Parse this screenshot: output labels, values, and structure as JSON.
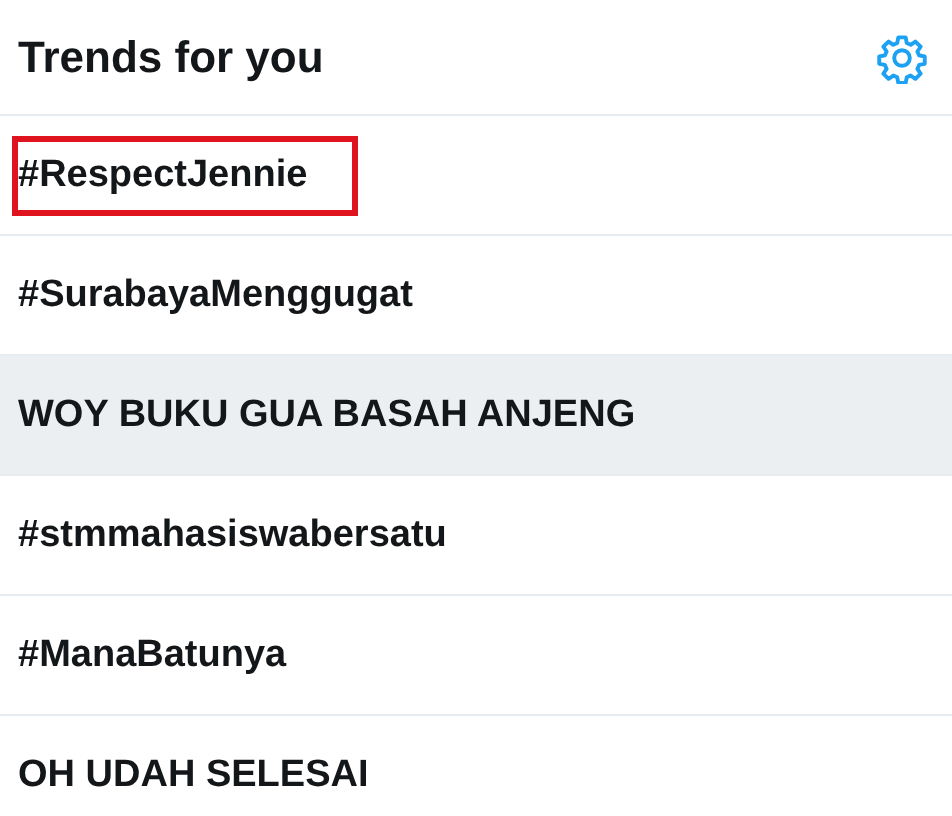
{
  "header": {
    "title": "Trends for you"
  },
  "trends": [
    {
      "label": "#RespectJennie",
      "highlighted": true,
      "hovered": false
    },
    {
      "label": "#SurabayaMenggugat",
      "highlighted": false,
      "hovered": false
    },
    {
      "label": "WOY BUKU GUA BASAH ANJENG",
      "highlighted": false,
      "hovered": true
    },
    {
      "label": "#stmmahasiswabersatu",
      "highlighted": false,
      "hovered": false
    },
    {
      "label": "#ManaBatunya",
      "highlighted": false,
      "hovered": false
    },
    {
      "label": "OH UDAH SELESAI",
      "highlighted": false,
      "hovered": false
    }
  ]
}
